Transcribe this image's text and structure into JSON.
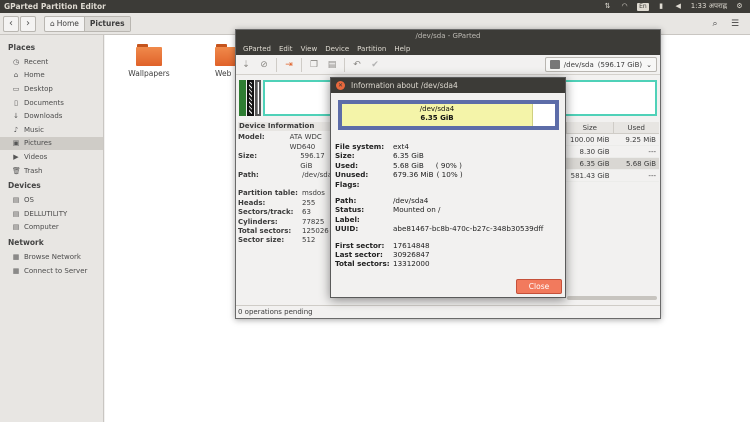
{
  "top_panel": {
    "title": "GParted Partition Editor",
    "lang": "En",
    "clock": "1:33 अपराह्न"
  },
  "nautilus": {
    "crumb_home": "Home",
    "crumb_current": "Pictures",
    "sidebar": {
      "places_label": "Places",
      "places": [
        {
          "label": "Recent",
          "icon": "clock-icon"
        },
        {
          "label": "Home",
          "icon": "home-icon"
        },
        {
          "label": "Desktop",
          "icon": "desktop-icon"
        },
        {
          "label": "Documents",
          "icon": "document-icon"
        },
        {
          "label": "Downloads",
          "icon": "download-icon"
        },
        {
          "label": "Music",
          "icon": "music-icon"
        },
        {
          "label": "Pictures",
          "icon": "picture-icon"
        },
        {
          "label": "Videos",
          "icon": "video-icon"
        },
        {
          "label": "Trash",
          "icon": "trash-icon"
        }
      ],
      "devices_label": "Devices",
      "devices": [
        {
          "label": "OS"
        },
        {
          "label": "DELLUTILITY"
        },
        {
          "label": "Computer"
        }
      ],
      "network_label": "Network",
      "network": [
        {
          "label": "Browse Network"
        },
        {
          "label": "Connect to Server"
        }
      ]
    },
    "folders": [
      "Wallpapers",
      "Web"
    ]
  },
  "gparted": {
    "window_title": "/dev/sda - GParted",
    "menu": [
      "GParted",
      "Edit",
      "View",
      "Device",
      "Partition",
      "Help"
    ],
    "device_select": "/dev/sda",
    "device_size": "(596.17 GiB)",
    "device_info": {
      "header": "Device Information",
      "rows": [
        {
          "k": "Model:",
          "v": "ATA WDC WD640"
        },
        {
          "k": "Size:",
          "v": "596.17 GiB"
        },
        {
          "k": "Path:",
          "v": "/dev/sda"
        }
      ],
      "rows2": [
        {
          "k": "Partition table:",
          "v": "msdos"
        },
        {
          "k": "Heads:",
          "v": "255"
        },
        {
          "k": "Sectors/track:",
          "v": "63"
        },
        {
          "k": "Cylinders:",
          "v": "77825"
        },
        {
          "k": "Total sectors:",
          "v": "125026"
        },
        {
          "k": "Sector size:",
          "v": "512"
        }
      ]
    },
    "table": {
      "headers": [
        "Size",
        "Used"
      ],
      "rows": [
        [
          "100.00 MiB",
          "9.25 MiB"
        ],
        [
          "8.30 GiB",
          "---"
        ],
        [
          "6.35 GiB",
          "5.68 GiB"
        ],
        [
          "581.43 GiB",
          "---"
        ]
      ],
      "partial_label": "ITY"
    },
    "status": "0 operations pending"
  },
  "dialog": {
    "title": "Information about /dev/sda4",
    "graph_name": "/dev/sda4",
    "graph_size": "6.35 GiB",
    "used_fraction": 0.895,
    "fields": [
      {
        "k": "File system:",
        "v": "ext4"
      },
      {
        "k": "Size:",
        "v": "6.35 GiB"
      },
      {
        "k": "Used:",
        "v": "5.68 GiB",
        "pct": "( 90% )"
      },
      {
        "k": "Unused:",
        "v": "679.36 MiB",
        "pct": "( 10% )"
      },
      {
        "k": "Flags:",
        "v": ""
      }
    ],
    "fields2": [
      {
        "k": "Path:",
        "v": "/dev/sda4"
      },
      {
        "k": "Status:",
        "v": "Mounted on /"
      },
      {
        "k": "Label:",
        "v": ""
      },
      {
        "k": "UUID:",
        "v": "abe81467-bc8b-470c-b27c-348b30539dff"
      }
    ],
    "fields3": [
      {
        "k": "First sector:",
        "v": "17614848"
      },
      {
        "k": "Last sector:",
        "v": "30926847"
      },
      {
        "k": "Total sectors:",
        "v": "13312000"
      }
    ],
    "close_label": "Close"
  },
  "colors": {
    "accent": "#f27a5d",
    "panel": "#3c3b37",
    "partition_border": "#4fd1b8",
    "fs_ext4": "#5c6ca8",
    "used_fill": "#f4f4a9"
  }
}
